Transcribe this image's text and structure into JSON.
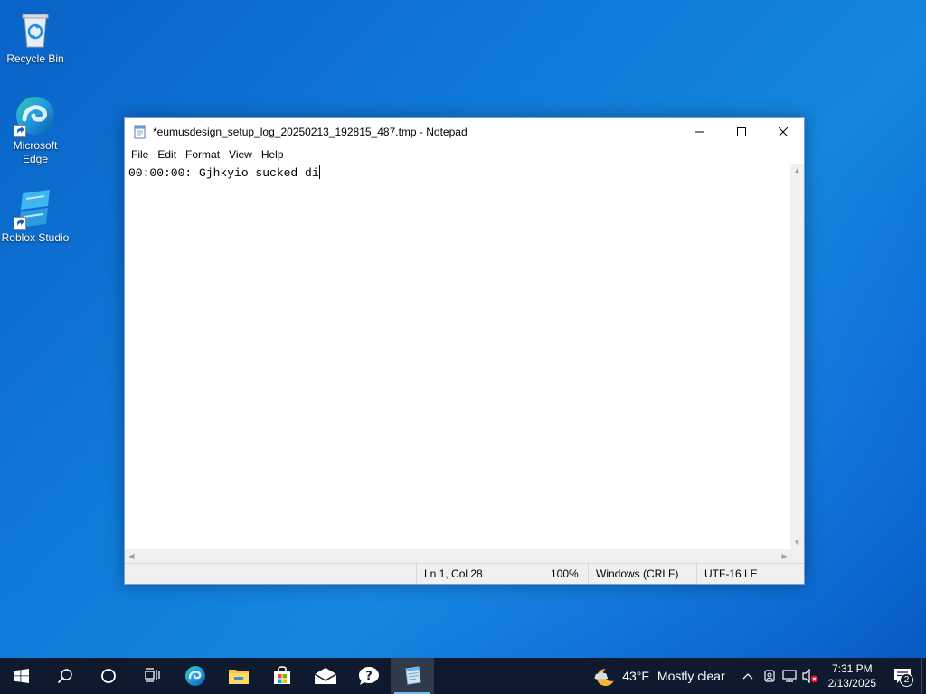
{
  "desktop": {
    "icons": [
      {
        "label": "Recycle Bin"
      },
      {
        "label": "Microsoft Edge"
      },
      {
        "label": "Roblox Studio"
      }
    ]
  },
  "notepad": {
    "title": "*eumusdesign_setup_log_20250213_192815_487.tmp - Notepad",
    "menu": [
      "File",
      "Edit",
      "Format",
      "View",
      "Help"
    ],
    "content": "00:00:00: Gjhkyio sucked di",
    "status": {
      "position": "Ln 1, Col 28",
      "zoom": "100%",
      "line_ending": "Windows (CRLF)",
      "encoding": "UTF-16 LE"
    }
  },
  "taskbar": {
    "icons": [
      "windows-start-icon",
      "search-icon",
      "cortana-icon",
      "task-view-icon",
      "edge-icon",
      "file-explorer-icon",
      "microsoft-store-icon",
      "mail-icon",
      "get-help-icon",
      "notepad-icon"
    ],
    "weather": {
      "temp": "43°F",
      "condition": "Mostly clear"
    },
    "clock": {
      "time": "7:31 PM",
      "date": "2/13/2025"
    },
    "notifications_count": "2"
  },
  "colors": {
    "accent": "#76b9ed",
    "taskbar": "#0f1a2e"
  }
}
